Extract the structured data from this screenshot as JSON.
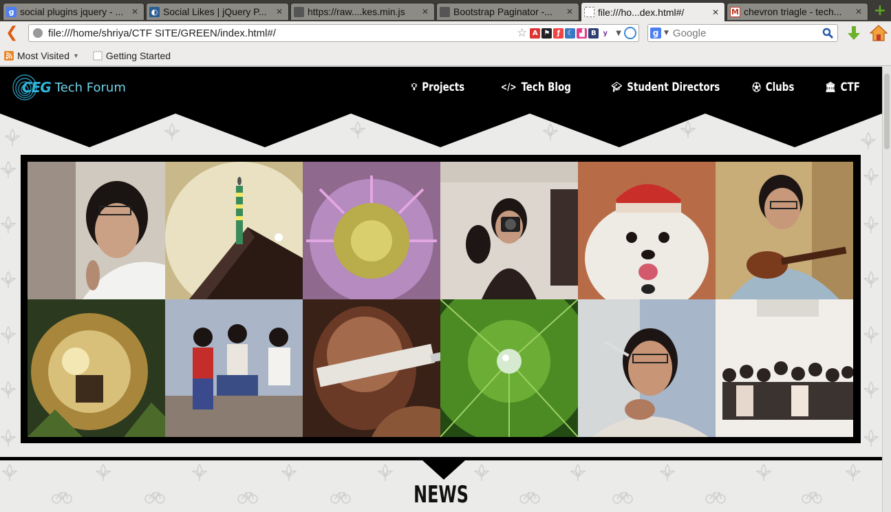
{
  "browser": {
    "tabs": [
      {
        "label": "social plugins jquery - ...",
        "icon": "google-icon",
        "active": false
      },
      {
        "label": "Social Likes | jQuery P...",
        "icon": "jquery-icon",
        "active": false
      },
      {
        "label": "https://raw....kes.min.js",
        "icon": "page-icon",
        "active": false
      },
      {
        "label": "Bootstrap Paginator -...",
        "icon": "page-icon",
        "active": false
      },
      {
        "label": "file:///ho...dex.html#/",
        "icon": "blank-page-icon",
        "active": true
      },
      {
        "label": "chevron triagle - tech...",
        "icon": "gmail-icon",
        "active": false
      }
    ],
    "url": "file:///home/shriya/CTF SITE/GREEN/index.html#/",
    "search_engine": "Google",
    "search_placeholder": "Google",
    "bookmarks": [
      {
        "label": "Most Visited",
        "has_dropdown": true,
        "icon": "rss-icon"
      },
      {
        "label": "Getting Started",
        "has_dropdown": false,
        "icon": "page-icon"
      }
    ]
  },
  "site": {
    "logo_mark": "CEG",
    "logo_text": "Tech Forum",
    "menu": [
      {
        "label": "Projects",
        "icon": "lightbulb-icon"
      },
      {
        "label": "Tech Blog",
        "icon": "code-icon"
      },
      {
        "label": "Student Directors",
        "icon": "graduation-cap-icon"
      },
      {
        "label": "Clubs",
        "icon": "soccer-ball-icon"
      },
      {
        "label": "CTF",
        "icon": "bank-icon"
      }
    ],
    "gallery": [
      "portrait-glasses",
      "birthday-cake-candle",
      "purple-flower",
      "camera-selfie",
      "dog-santa-hat",
      "ukulele-player",
      "christmas-bauble",
      "jumping-friends",
      "syringe-closeup",
      "water-drop-leaf",
      "spoon-tasting",
      "group-photo"
    ],
    "news_heading": "NEWS",
    "colors": {
      "header_bg": "#000000",
      "accent": "#2fb6d8",
      "page_bg": "#ebebea"
    }
  }
}
